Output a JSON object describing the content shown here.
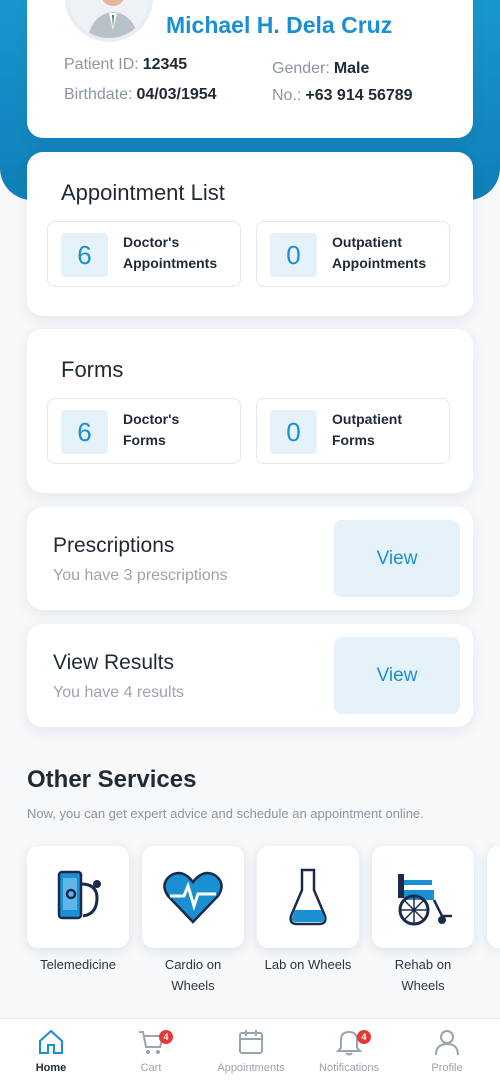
{
  "patient": {
    "name": "Michael H. Dela Cruz",
    "id_label": "Patient ID:",
    "id_value": "12345",
    "gender_label": "Gender:",
    "gender_value": "Male",
    "birthdate_label": "Birthdate:",
    "birthdate_value": "04/03/1954",
    "phone_label": "No.:",
    "phone_value": "+63 914 56789"
  },
  "appointments": {
    "title": "Appointment List",
    "tiles": [
      {
        "count": "6",
        "line1": "Doctor's",
        "line2": "Appointments"
      },
      {
        "count": "0",
        "line1": "Outpatient",
        "line2": "Appointments"
      }
    ]
  },
  "forms": {
    "title": "Forms",
    "tiles": [
      {
        "count": "6",
        "line1": "Doctor's",
        "line2": "Forms"
      },
      {
        "count": "0",
        "line1": "Outpatient",
        "line2": "Forms"
      }
    ]
  },
  "prescriptions": {
    "title": "Prescriptions",
    "subtitle": "You have 3 prescriptions",
    "button": "View"
  },
  "results": {
    "title": "View Results",
    "subtitle": "You have 4 results",
    "button": "View"
  },
  "other_services": {
    "title": "Other Services",
    "subtitle": "Now, you can get expert advice and schedule an appointment online.",
    "items": [
      {
        "label": "Telemedicine",
        "icon": "stethoscope-phone-icon"
      },
      {
        "label": "Cardio on Wheels",
        "icon": "heart-pulse-icon"
      },
      {
        "label": "Lab on Wheels",
        "icon": "flask-icon"
      },
      {
        "label": "Rehab on Wheels",
        "icon": "wheelchair-icon"
      }
    ]
  },
  "tabbar": {
    "items": [
      {
        "label": "Home",
        "icon": "home-icon",
        "active": true
      },
      {
        "label": "Cart",
        "icon": "cart-icon",
        "badge": "4"
      },
      {
        "label": "Appointments",
        "icon": "calendar-icon"
      },
      {
        "label": "Notifications",
        "icon": "bell-icon",
        "badge": "4"
      },
      {
        "label": "Profile",
        "icon": "profile-icon"
      }
    ]
  },
  "colors": {
    "accent": "#1a8fd1",
    "header_gradient_top": "#1a97cf",
    "badge": "#e53935",
    "tile_bg": "#e6f2fa"
  }
}
